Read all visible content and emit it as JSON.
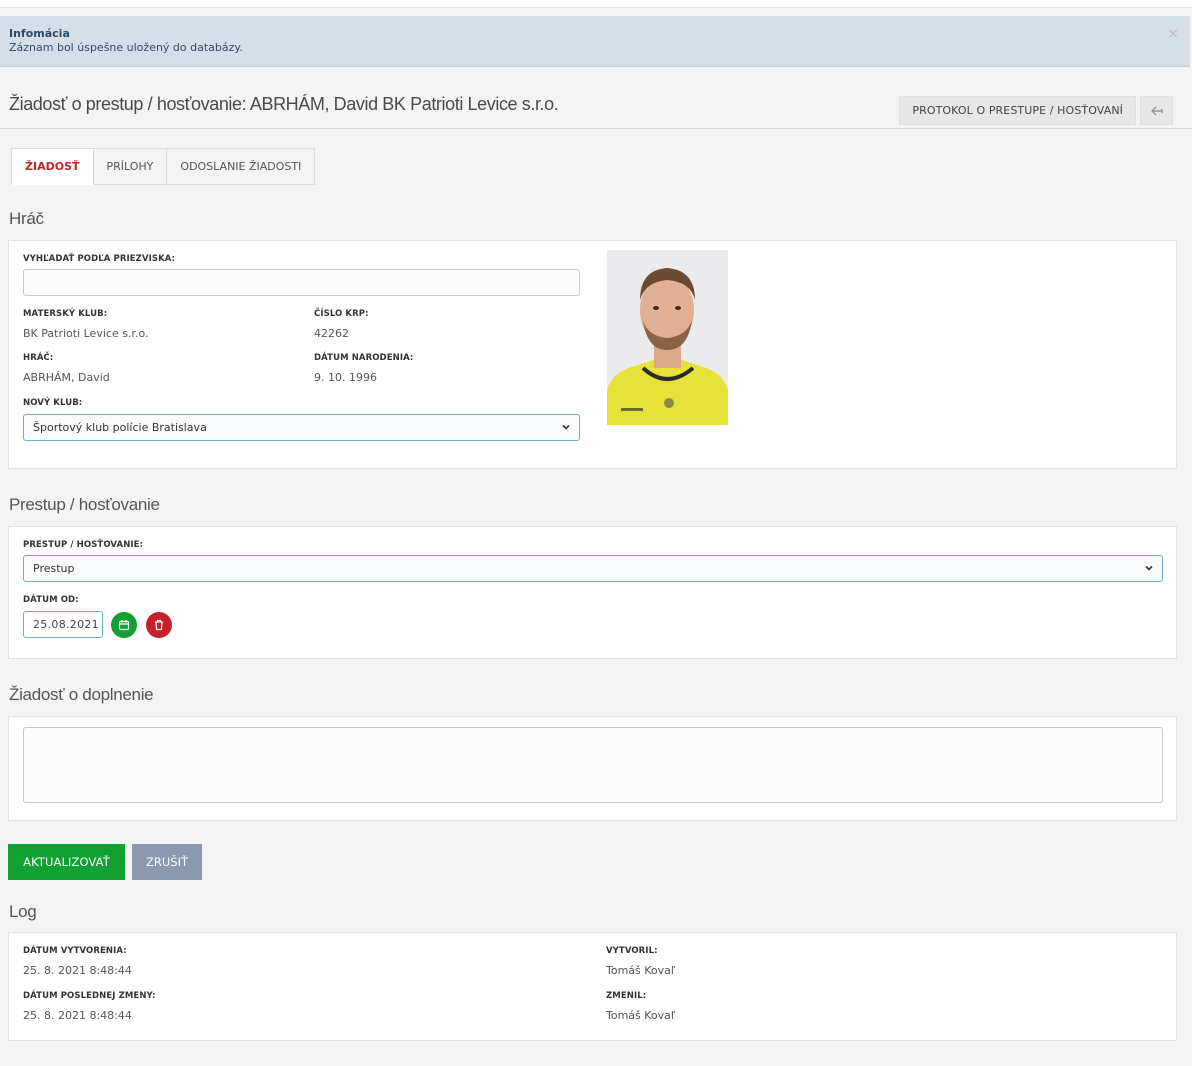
{
  "alert": {
    "title": "Infomácia",
    "message": "Záznam bol úspešne uložený do databázy.",
    "close": "×"
  },
  "header": {
    "title": "Žiadosť o prestup / hosťovanie: ABRHÁM, David BK Patrioti Levice s.r.o.",
    "protocol_button": "PROTOKOL O PRESTUPE / HOSŤOVANÍ"
  },
  "tabs": [
    {
      "label": "ŽIADOSŤ",
      "active": true
    },
    {
      "label": "PRÍLOHY",
      "active": false
    },
    {
      "label": "ODOSLANIE ŽIADOSTI",
      "active": false
    }
  ],
  "player": {
    "section_title": "Hráč",
    "search_label": "VYHĽADAŤ PODĽA PRIEZVISKA:",
    "search_value": "",
    "home_club_label": "MATERSKÝ KLUB:",
    "home_club": "BK Patrioti Levice s.r.o.",
    "krp_label": "ČÍSLO KRP:",
    "krp": "42262",
    "player_label": "HRÁČ:",
    "player_name": "ABRHÁM, David",
    "birth_label": "DÁTUM NARODENIA:",
    "birth_date": "9. 10. 1996",
    "new_club_label": "NOVÝ KLUB:",
    "new_club": "Športový klub polície Bratislava"
  },
  "transfer": {
    "section_title": "Prestup / hosťovanie",
    "type_label": "PRESTUP / HOSŤOVANIE:",
    "type_value": "Prestup",
    "date_label": "DÁTUM OD:",
    "date_value": "25.08.2021"
  },
  "supplement": {
    "section_title": "Žiadosť o doplnenie",
    "value": ""
  },
  "actions": {
    "update": "AKTUALIZOVAŤ",
    "cancel": "ZRUŠIŤ"
  },
  "log": {
    "section_title": "Log",
    "created_label": "DÁTUM VYTVORENIA:",
    "created": "25. 8. 2021 8:48:44",
    "created_by_label": "VYTVORIL:",
    "created_by": "Tomáš Kovaľ",
    "modified_label": "DÁTUM POSLEDNEJ ZMENY:",
    "modified": "25. 8. 2021 8:48:44",
    "modified_by_label": "ZMENIL:",
    "modified_by": "Tomáš Kovaľ"
  },
  "colors": {
    "accent_red": "#c0272d",
    "success_green": "#11a031",
    "danger_red": "#c8202a",
    "alert_bg": "#d6dee8"
  }
}
